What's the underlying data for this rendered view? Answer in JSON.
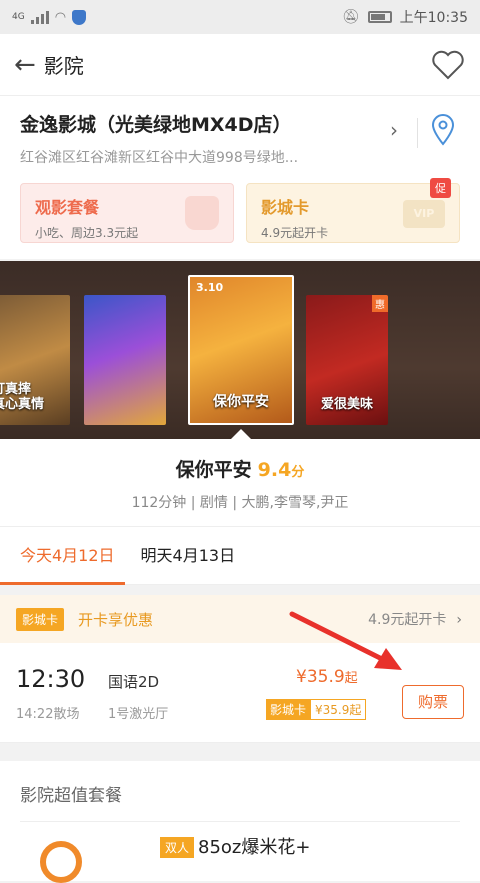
{
  "status_bar": {
    "network": "4G",
    "time": "上午10:35"
  },
  "header": {
    "title": "影院"
  },
  "cinema": {
    "name": "金逸影城（光美绿地MX4D店）",
    "address": "红谷滩区红谷滩新区红谷中大道998号绿地..."
  },
  "cards": {
    "package": {
      "title": "观影套餐",
      "sub": "小吃、周边3.3元起"
    },
    "vip": {
      "title": "影城卡",
      "sub": "4.9元起开卡",
      "badge": "促",
      "deco": "VIP"
    }
  },
  "posters": {
    "p1_text": "打真摔\n真心真情",
    "p3_date": "3.10",
    "p3_text": "保你平安",
    "p4_badge": "惠",
    "p4_text": "爱很美味"
  },
  "movie": {
    "title": "保你平安",
    "score": "9.4",
    "score_unit": "分",
    "meta": "112分钟 | 剧情 | 大鹏,李雪琴,尹正"
  },
  "date_tabs": [
    {
      "label": "今天4月12日",
      "active": true
    },
    {
      "label": "明天4月13日",
      "active": false
    }
  ],
  "promo": {
    "tag": "影城卡",
    "text": "开卡享优惠",
    "right": "4.9元起开卡"
  },
  "showtime": {
    "start": "12:30",
    "end": "14:22散场",
    "lang": "国语2D",
    "hall": "1号激光厅",
    "price": "¥35.9",
    "price_suffix": "起",
    "vip_tag": "影城卡",
    "vip_price": "¥35.9起",
    "buy": "购票"
  },
  "combos": {
    "title": "影院超值套餐",
    "tag": "双人",
    "item_name": "85oz爆米花+"
  },
  "colors": {
    "accent": "#ee6b2d",
    "gold": "#f5a623",
    "red_arrow": "#e8312b"
  }
}
